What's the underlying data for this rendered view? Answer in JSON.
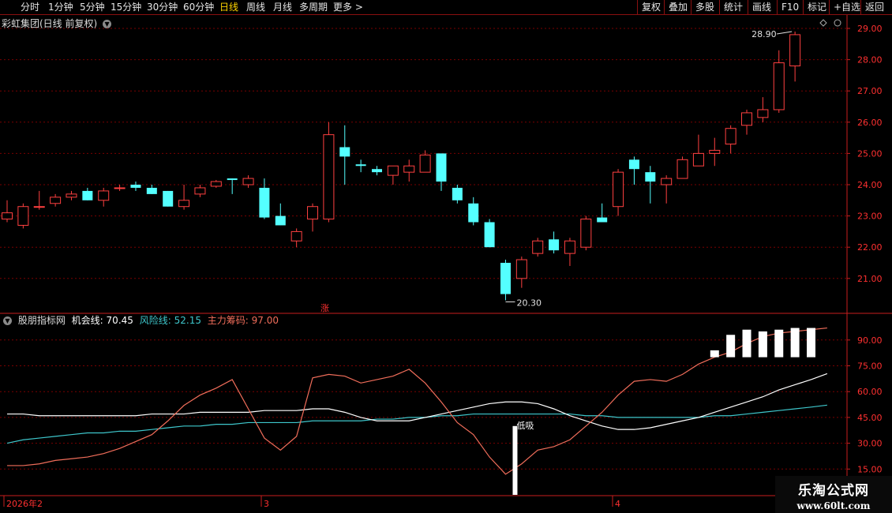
{
  "toolbar": {
    "periods": [
      {
        "label": "分时",
        "name": "tab-intraday"
      },
      {
        "label": "1分钟",
        "name": "tab-1min"
      },
      {
        "label": "5分钟",
        "name": "tab-5min"
      },
      {
        "label": "15分钟",
        "name": "tab-15min"
      },
      {
        "label": "30分钟",
        "name": "tab-30min"
      },
      {
        "label": "60分钟",
        "name": "tab-60min"
      },
      {
        "label": "日线",
        "name": "tab-daily",
        "active": true
      },
      {
        "label": "周线",
        "name": "tab-weekly"
      },
      {
        "label": "月线",
        "name": "tab-monthly"
      },
      {
        "label": "多周期",
        "name": "tab-multi-period"
      },
      {
        "label": "更多 >",
        "name": "tab-more"
      }
    ],
    "actions": [
      {
        "label": "复权",
        "name": "restore-rights-button"
      },
      {
        "label": "叠加",
        "name": "overlay-button"
      },
      {
        "label": "多股",
        "name": "multi-stock-button"
      },
      {
        "label": "统计",
        "name": "statistics-button"
      },
      {
        "label": "画线",
        "name": "draw-line-button"
      },
      {
        "label": "F10",
        "name": "f10-button"
      },
      {
        "label": "标记",
        "name": "mark-button"
      },
      {
        "label": "+自选",
        "name": "add-watchlist-button"
      },
      {
        "label": "返回",
        "name": "back-button"
      }
    ]
  },
  "chart_title": "彩虹集团(日线 前复权)",
  "price_axis": {
    "labels": [
      "29.00",
      "28.00",
      "27.00",
      "26.00",
      "25.00",
      "24.00",
      "23.00",
      "22.00",
      "21.00"
    ],
    "min": 20.0,
    "max": 29.3
  },
  "annotations": {
    "high": "28.90",
    "low": "20.30",
    "rise_marker": "涨",
    "low_suck": "低吸"
  },
  "indicator": {
    "name": "股朋指标网",
    "opportunity_label": "机会线:",
    "opportunity_value": "70.45",
    "risk_label": "风险线:",
    "risk_value": "52.15",
    "chips_label": "主力筹码:",
    "chips_value": "97.00",
    "axis_labels": [
      "90.00",
      "75.00",
      "60.00",
      "45.00",
      "30.00",
      "15.00"
    ]
  },
  "date_axis": {
    "labels": [
      "2026年2",
      "3",
      "4"
    ]
  },
  "watermark": {
    "main": "乐淘公式网",
    "sub": "www.60lt.com"
  },
  "colors": {
    "up": "#ff4040",
    "down": "#54ffff",
    "grid": "#7a0000",
    "axis": "#c81e1e",
    "opp_line": "#ffffff",
    "risk_line": "#3ec7cc",
    "chips_line": "#f06d5a"
  },
  "chart_data": {
    "type": "candlestick",
    "candles": [
      {
        "o": 22.9,
        "h": 23.5,
        "l": 22.8,
        "c": 23.1
      },
      {
        "o": 22.7,
        "h": 23.4,
        "l": 22.6,
        "c": 23.3
      },
      {
        "o": 23.3,
        "h": 23.8,
        "l": 23.2,
        "c": 23.3
      },
      {
        "o": 23.4,
        "h": 23.7,
        "l": 23.3,
        "c": 23.6
      },
      {
        "o": 23.6,
        "h": 23.8,
        "l": 23.5,
        "c": 23.7
      },
      {
        "o": 23.8,
        "h": 23.9,
        "l": 23.5,
        "c": 23.5
      },
      {
        "o": 23.5,
        "h": 23.9,
        "l": 23.3,
        "c": 23.8
      },
      {
        "o": 23.9,
        "h": 24.0,
        "l": 23.8,
        "c": 23.9
      },
      {
        "o": 24.0,
        "h": 24.1,
        "l": 23.8,
        "c": 23.9
      },
      {
        "o": 23.9,
        "h": 24.0,
        "l": 23.7,
        "c": 23.7
      },
      {
        "o": 23.8,
        "h": 23.8,
        "l": 23.3,
        "c": 23.3
      },
      {
        "o": 23.3,
        "h": 24.0,
        "l": 23.2,
        "c": 23.5
      },
      {
        "o": 23.7,
        "h": 24.0,
        "l": 23.6,
        "c": 23.9
      },
      {
        "o": 23.95,
        "h": 24.15,
        "l": 23.9,
        "c": 24.1
      },
      {
        "o": 24.2,
        "h": 24.2,
        "l": 23.7,
        "c": 24.15
      },
      {
        "o": 24.0,
        "h": 24.3,
        "l": 23.9,
        "c": 24.2
      },
      {
        "o": 23.9,
        "h": 24.2,
        "l": 22.9,
        "c": 22.95
      },
      {
        "o": 23.0,
        "h": 23.4,
        "l": 22.7,
        "c": 22.7
      },
      {
        "o": 22.2,
        "h": 22.6,
        "l": 22.0,
        "c": 22.5
      },
      {
        "o": 22.9,
        "h": 23.4,
        "l": 22.5,
        "c": 23.3
      },
      {
        "o": 22.9,
        "h": 26.0,
        "l": 22.8,
        "c": 25.6
      },
      {
        "o": 25.2,
        "h": 25.9,
        "l": 24.0,
        "c": 24.9
      },
      {
        "o": 24.65,
        "h": 24.8,
        "l": 24.4,
        "c": 24.6
      },
      {
        "o": 24.5,
        "h": 24.6,
        "l": 24.3,
        "c": 24.4
      },
      {
        "o": 24.3,
        "h": 24.6,
        "l": 24.0,
        "c": 24.6
      },
      {
        "o": 24.4,
        "h": 24.8,
        "l": 24.1,
        "c": 24.6
      },
      {
        "o": 24.4,
        "h": 25.1,
        "l": 24.4,
        "c": 24.95
      },
      {
        "o": 25.0,
        "h": 25.0,
        "l": 23.8,
        "c": 24.1
      },
      {
        "o": 23.9,
        "h": 24.0,
        "l": 23.4,
        "c": 23.5
      },
      {
        "o": 23.4,
        "h": 23.6,
        "l": 22.7,
        "c": 22.8
      },
      {
        "o": 22.8,
        "h": 22.9,
        "l": 22.0,
        "c": 22.0
      },
      {
        "o": 21.5,
        "h": 21.6,
        "l": 20.3,
        "c": 20.5
      },
      {
        "o": 21.0,
        "h": 21.7,
        "l": 20.7,
        "c": 21.6
      },
      {
        "o": 21.8,
        "h": 22.3,
        "l": 21.7,
        "c": 22.2
      },
      {
        "o": 22.25,
        "h": 22.5,
        "l": 21.8,
        "c": 21.9
      },
      {
        "o": 21.8,
        "h": 22.3,
        "l": 21.4,
        "c": 22.2
      },
      {
        "o": 22.0,
        "h": 23.0,
        "l": 21.9,
        "c": 22.9
      },
      {
        "o": 22.95,
        "h": 23.4,
        "l": 22.9,
        "c": 22.8
      },
      {
        "o": 23.3,
        "h": 24.5,
        "l": 23.0,
        "c": 24.4
      },
      {
        "o": 24.8,
        "h": 24.9,
        "l": 24.0,
        "c": 24.5
      },
      {
        "o": 24.4,
        "h": 24.6,
        "l": 23.4,
        "c": 24.1
      },
      {
        "o": 24.0,
        "h": 24.3,
        "l": 23.4,
        "c": 24.2
      },
      {
        "o": 24.2,
        "h": 24.9,
        "l": 24.2,
        "c": 24.8
      },
      {
        "o": 24.6,
        "h": 25.6,
        "l": 24.6,
        "c": 25.0
      },
      {
        "o": 25.0,
        "h": 25.5,
        "l": 24.6,
        "c": 25.1
      },
      {
        "o": 25.3,
        "h": 25.9,
        "l": 25.0,
        "c": 25.8
      },
      {
        "o": 25.9,
        "h": 26.4,
        "l": 25.6,
        "c": 26.3
      },
      {
        "o": 26.15,
        "h": 26.8,
        "l": 26.0,
        "c": 26.4
      },
      {
        "o": 26.4,
        "h": 28.3,
        "l": 26.3,
        "c": 27.9
      },
      {
        "o": 27.8,
        "h": 28.9,
        "l": 27.3,
        "c": 28.8
      }
    ],
    "indicator_series": {
      "range": [
        0,
        100
      ],
      "opportunity_line": [
        47,
        47,
        46,
        46,
        46,
        46,
        46,
        46,
        46,
        47,
        47,
        47,
        48,
        48,
        48,
        48,
        49,
        49,
        49,
        50,
        50,
        48,
        45,
        43,
        43,
        43,
        45,
        47,
        49,
        51,
        53,
        54,
        54,
        53,
        50,
        46,
        43,
        40,
        38,
        38,
        39,
        41,
        43,
        45,
        48,
        51,
        54,
        57,
        61,
        64,
        67,
        70.45
      ],
      "risk_line": [
        30,
        32,
        33,
        34,
        35,
        36,
        36,
        37,
        37,
        38,
        39,
        40,
        40,
        41,
        41,
        42,
        42,
        42,
        42,
        43,
        43,
        43,
        43,
        44,
        44,
        45,
        45,
        46,
        46,
        47,
        47,
        47,
        47,
        47,
        47,
        47,
        46,
        46,
        45,
        45,
        45,
        45,
        45,
        45,
        46,
        46,
        47,
        48,
        49,
        50,
        51,
        52.15
      ],
      "chips_line": [
        17,
        17,
        18,
        20,
        21,
        22,
        24,
        27,
        31,
        35,
        43,
        52,
        58,
        62,
        67,
        50,
        33,
        26,
        34,
        68,
        70,
        69,
        65,
        67,
        69,
        73,
        65,
        54,
        42,
        35,
        22,
        12,
        18,
        26,
        28,
        32,
        40,
        48,
        58,
        66,
        67,
        66,
        70,
        76,
        80,
        83,
        88,
        92,
        94,
        95,
        96,
        97
      ]
    },
    "signal_bars": [
      {
        "index": 31,
        "value": 40,
        "label": "低吸"
      }
    ],
    "chip_bars": [
      {
        "index": 44,
        "value": 84
      },
      {
        "index": 45,
        "value": 93
      },
      {
        "index": 46,
        "value": 96
      },
      {
        "index": 47,
        "value": 95
      },
      {
        "index": 48,
        "value": 96
      },
      {
        "index": 49,
        "value": 97
      },
      {
        "index": 50,
        "value": 97
      }
    ]
  }
}
